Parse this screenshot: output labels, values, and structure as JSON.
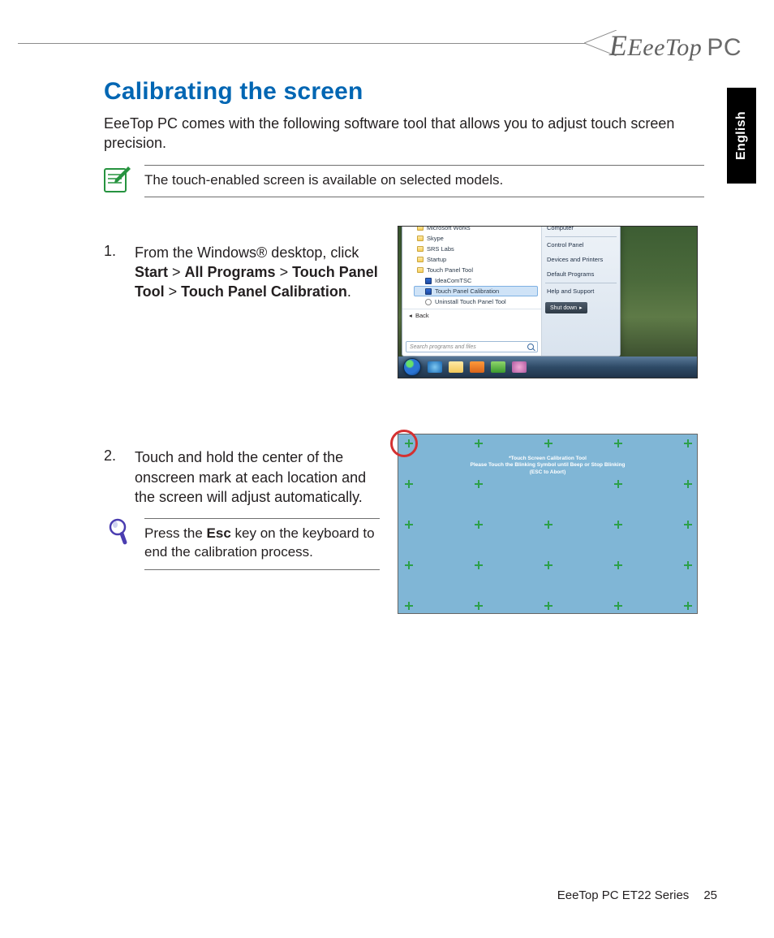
{
  "brand": {
    "text": "EeeTop",
    "suffix": "PC"
  },
  "lang_tab": "English",
  "heading": "Calibrating the screen",
  "intro": "EeeTop PC comes with the following software tool that allows you to adjust touch screen precision.",
  "note": "The touch-enabled screen is available on selected models.",
  "step1": {
    "num": "1.",
    "pre": "From the Windows® desktop, click ",
    "b1": "Start",
    "gt1": " > ",
    "b2": "All Programs",
    "gt2": " > ",
    "b3": "Touch Panel Tool",
    "gt3": " > ",
    "b4": "Touch Panel Calibration",
    "post": "."
  },
  "start_menu": {
    "programs": [
      "Microsoft Works",
      "Skype",
      "SRS Labs",
      "Startup",
      "Touch Panel Tool"
    ],
    "subitems": {
      "idea": "IdeaComTSC",
      "cal": "Touch Panel Calibration",
      "uninst": "Uninstall Touch Panel Tool"
    },
    "back": "Back",
    "search_placeholder": "Search programs and files",
    "system": [
      "Computer",
      "Control Panel",
      "Devices and Printers",
      "Default Programs",
      "Help and Support"
    ],
    "shutdown": "Shut down"
  },
  "step2": {
    "num": "2.",
    "text": "Touch and hold the center of the onscreen mark at each location and the screen will adjust automatically."
  },
  "tip": {
    "pre": "Press the ",
    "b": "Esc",
    "post": " key on the keyboard to end the calibration process."
  },
  "cal_screen": {
    "line1": "*Touch Screen Calibration Tool",
    "line2": "Please Touch the Blinking Symbol until Beep or Stop Blinking",
    "line3": "(ESC to Abort)"
  },
  "footer": {
    "series": "EeeTop PC ET22 Series",
    "page": "25"
  }
}
